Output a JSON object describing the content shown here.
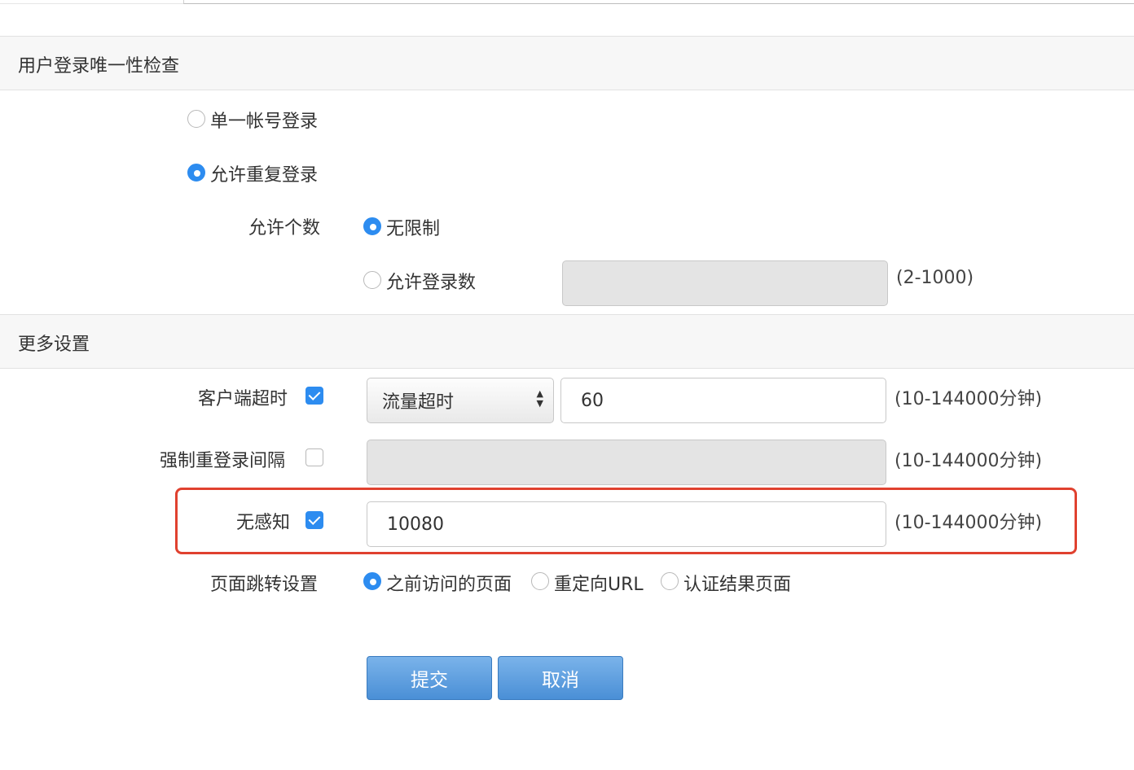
{
  "section_login": {
    "title": "用户登录唯一性检查",
    "single_account_label": "单一帐号登录",
    "allow_duplicate_label": "允许重复登录",
    "allowed_count_label": "允许个数",
    "unlimited_label": "无限制",
    "allowed_login_count_label": "允许登录数",
    "allowed_login_count_value": "",
    "allowed_login_count_range": "(2-1000)",
    "selected": "allow_duplicate",
    "count_selected": "unlimited"
  },
  "section_more": {
    "title": "更多设置",
    "client_timeout": {
      "label": "客户端超时",
      "checked": true,
      "select_value": "流量超时",
      "value": "60",
      "range": "(10-144000分钟)"
    },
    "force_relogin": {
      "label": "强制重登录间隔",
      "checked": false,
      "value": "",
      "range": "(10-144000分钟)"
    },
    "seamless": {
      "label": "无感知",
      "checked": true,
      "value": "10080",
      "range": "(10-144000分钟)"
    },
    "redirect": {
      "label": "页面跳转设置",
      "options": [
        "之前访问的页面",
        "重定向URL",
        "认证结果页面"
      ],
      "selected_index": 0
    }
  },
  "buttons": {
    "submit": "提交",
    "cancel": "取消"
  },
  "colors": {
    "accent": "#2d8cf0",
    "highlight": "#e0412f",
    "button": "#5b9de0"
  }
}
